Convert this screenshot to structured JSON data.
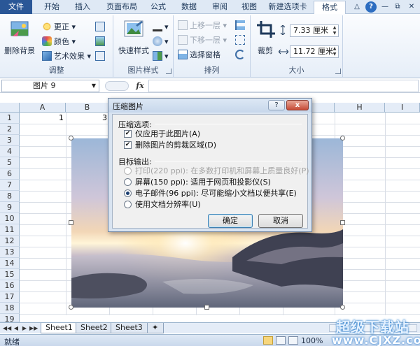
{
  "tabs": [
    "文件",
    "开始",
    "插入",
    "页面布局",
    "公式",
    "数据",
    "审阅",
    "视图",
    "新建选项卡",
    "格式"
  ],
  "active_tab": "格式",
  "ribbon": {
    "adjust": {
      "remove_bg": "删除背景",
      "corrections": "更正",
      "color": "颜色",
      "artistic": "艺术效果",
      "label": "调整"
    },
    "picture_styles": {
      "quick_styles": "快速样式",
      "label": "图片样式"
    },
    "arrange": {
      "bring_forward": "上移一层",
      "send_backward": "下移一层",
      "selection_pane": "选择窗格",
      "label": "排列"
    },
    "size": {
      "crop": "裁剪",
      "height": "7.33 厘米",
      "width": "11.72 厘米",
      "label": "大小"
    }
  },
  "formula_bar": {
    "name_box": "图片 9",
    "fx": "fx",
    "value": ""
  },
  "grid": {
    "columns": [
      "A",
      "B",
      "C",
      "D",
      "E",
      "F",
      "G",
      "H",
      "I"
    ],
    "rows": [
      "1",
      "2",
      "3",
      "4",
      "5",
      "6",
      "7",
      "8",
      "9",
      "10",
      "11",
      "12",
      "13",
      "14",
      "15",
      "16",
      "17",
      "18",
      "19"
    ],
    "cells": {
      "A1": "1",
      "B1": "3"
    }
  },
  "dialog": {
    "title": "压缩图片",
    "help": "?",
    "close": "x",
    "compression_options_label": "压缩选项:",
    "apply_only_this": "仅应用于此图片(A)",
    "delete_cropped": "删除图片的剪裁区域(D)",
    "target_output_label": "目标输出:",
    "print_option": "打印(220 ppi): 在多数打印机和屏幕上质量良好(P)",
    "screen_option": "屏幕(150 ppi): 适用于网页和投影仪(S)",
    "email_option": "电子邮件(96 ppi): 尽可能缩小文档以便共享(E)",
    "document_option": "使用文档分辨率(U)",
    "ok": "确定",
    "cancel": "取消"
  },
  "sheet_tabs": [
    "Sheet1",
    "Sheet2",
    "Sheet3"
  ],
  "active_sheet": "Sheet1",
  "status": {
    "ready": "就绪",
    "zoom": "100%"
  },
  "watermark": {
    "line1": "超级下载站",
    "line2": "www.CJXZ.com"
  }
}
